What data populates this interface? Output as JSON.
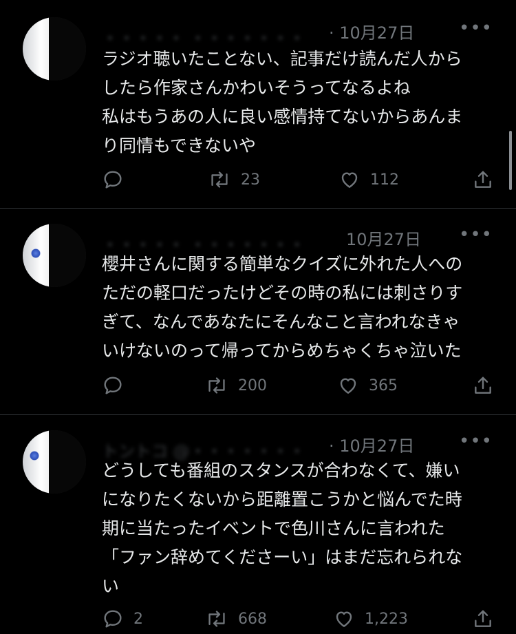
{
  "tweets": [
    {
      "handle_blurred": "・・・・・ ・・・・・・・",
      "date": "· 10月27日",
      "more": "•••",
      "lines": [
        "ラジオ聴いたことない、記事だけ読んだ人から",
        "したら作家さんかわいそうってなるよね",
        "私はもうあの人に良い感情持てないからあんま",
        "り同情もできないや"
      ],
      "reply_count": "",
      "retweet_count": "23",
      "like_count": "112"
    },
    {
      "handle_blurred": "・・・・・ ・・・・・・・",
      "date": "10月27日",
      "more": "•••",
      "lines": [
        "櫻井さんに関する簡単なクイズに外れた人への",
        "ただの軽口だったけどその時の私には刺さりす",
        "ぎて、なんであなたにそんなこと言われなきゃ",
        "いけないのって帰ってからめちゃくちゃ泣いた"
      ],
      "reply_count": "",
      "retweet_count": "200",
      "like_count": "365"
    },
    {
      "handle_blurred": "トントコ @・・・・・・・",
      "date": "· 10月27日",
      "more": "•••",
      "lines": [
        "どうしても番組のスタンスが合わなくて、嫌い",
        "になりたくないから距離置こうかと悩んでた時",
        "期に当たったイベントで色川さんに言われた",
        "「ファン辞めてくださーい」はまだ忘れられな",
        "い"
      ],
      "reply_count": "2",
      "retweet_count": "668",
      "like_count": "1,223"
    }
  ]
}
